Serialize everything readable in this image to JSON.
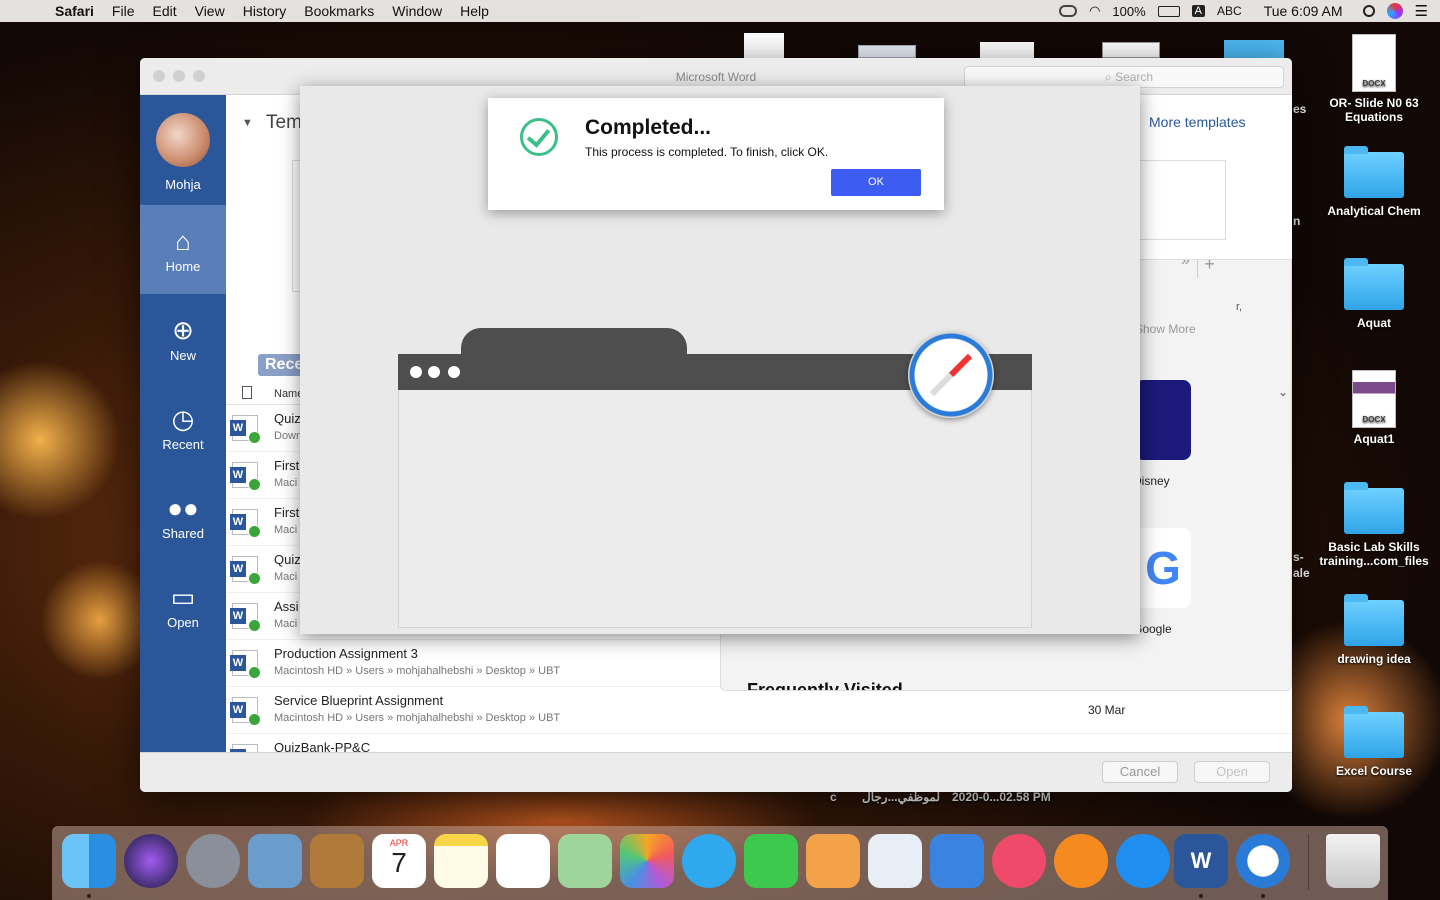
{
  "menubar": {
    "app": "Safari",
    "items": [
      "File",
      "Edit",
      "View",
      "History",
      "Bookmarks",
      "Window",
      "Help"
    ],
    "battery": "100%",
    "input": "ABC",
    "input_letter": "A",
    "clock": "Tue 6:09 AM"
  },
  "desktop": {
    "icons": [
      {
        "label": "OR- Slide N0 63 Equations",
        "kind": "docx",
        "badge": "DOCX"
      },
      {
        "label": "Analytical Chem",
        "kind": "folder"
      },
      {
        "label": "Aquat",
        "kind": "folder"
      },
      {
        "label": "Aquat1",
        "kind": "docx",
        "badge": "DOCX"
      },
      {
        "label": "Basic Lab Skills training...com_files",
        "kind": "folder"
      },
      {
        "label": "drawing idea",
        "kind": "folder"
      },
      {
        "label": "Excel Course",
        "kind": "folder"
      }
    ],
    "partial_labels": [
      "es",
      "n",
      "s-",
      "ale"
    ],
    "bottom_file": "2020-0...02.58 PM",
    "bottom_file_arabic": "لموظفي...رجال",
    "bottom_letter": "c"
  },
  "word": {
    "title": "Microsoft Word",
    "search_placeholder": "Search",
    "user": "Mohja",
    "sidebar": [
      "Home",
      "New",
      "Recent",
      "Shared",
      "Open"
    ],
    "templates_heading": "Tem",
    "more_templates": "More templates",
    "recent_tab": "Rece",
    "column_name": "Name",
    "rows": [
      {
        "title": "Quiz",
        "path": "Down",
        "date": ""
      },
      {
        "title": "First",
        "path": "Maci",
        "date": ""
      },
      {
        "title": "First",
        "path": "Maci",
        "date": ""
      },
      {
        "title": "Quiz",
        "path": "Maci",
        "date": ""
      },
      {
        "title": "Assi",
        "path": "Maci",
        "date": ""
      },
      {
        "title": "Production Assignment 3",
        "path": "Macintosh HD » Users » mohjahalhebshi » Desktop » UBT",
        "date": ""
      },
      {
        "title": "Service Blueprint Assignment",
        "path": "Macintosh HD » Users » mohjahalhebshi » Desktop » UBT",
        "date": "30 Mar"
      },
      {
        "title": "QuizBank-PP&C",
        "path": "",
        "date": ""
      }
    ],
    "cancel": "Cancel",
    "open": "Open",
    "show_more": "Show More",
    "disney": "Disney",
    "google": "Google",
    "freq": "Frequently Visited",
    "edge_text": "r,"
  },
  "dialog": {
    "title": "Completed...",
    "message": "This process is completed. To finish, click OK.",
    "ok": "OK"
  },
  "dock": [
    "finder",
    "siri",
    "launchpad",
    "preview",
    "contacts",
    "calendar",
    "notes",
    "reminders",
    "maps",
    "photos",
    "messages",
    "facetime",
    "pages",
    "numbers",
    "keynote",
    "music",
    "books",
    "app-store",
    "word",
    "safari",
    "trash"
  ],
  "calendar": {
    "month": "APR",
    "day": "7"
  }
}
